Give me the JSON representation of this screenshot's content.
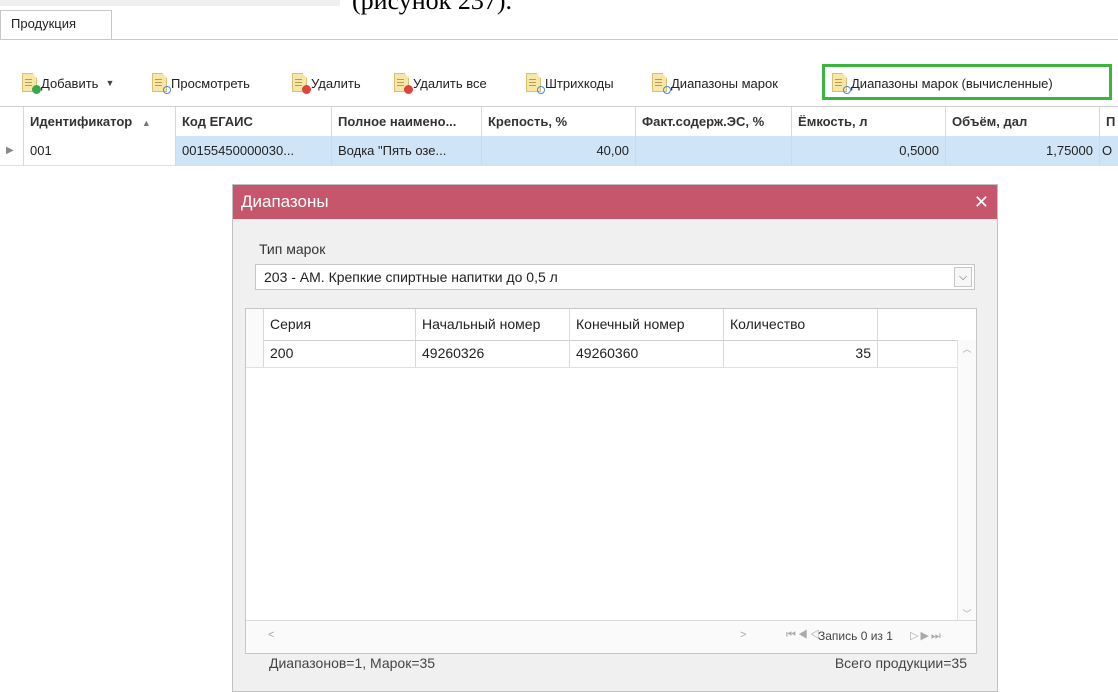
{
  "caption": "(рисунок 237).",
  "tab": {
    "label": "Продукция"
  },
  "toolbar": {
    "add": "Добавить",
    "view": "Просмотреть",
    "delete": "Удалить",
    "delete_all": "Удалить все",
    "barcodes": "Штрихкоды",
    "ranges": "Диапазоны марок",
    "ranges_calc": "Диапазоны марок (вычисленные)"
  },
  "grid": {
    "columns": [
      "Идентификатор",
      "Код ЕГАИС",
      "Полное наимено...",
      "Крепость, %",
      "Факт.содерж.ЭС, %",
      "Ёмкость, л",
      "Объём, дал",
      "П"
    ],
    "row": {
      "id": "001",
      "egais": "00155450000030...",
      "name": "Водка \"Пять озе...",
      "strength": "40,00",
      "fact": "",
      "capacity": "0,5000",
      "volume": "1,75000",
      "extra": "О"
    }
  },
  "dialog": {
    "title": "Диапазоны",
    "type_label": "Тип марок",
    "type_value": "203 - АМ. Крепкие спиртные напитки до 0,5 л",
    "columns": [
      "Серия",
      "Начальный номер",
      "Конечный номер",
      "Количество"
    ],
    "row": {
      "series": "200",
      "start": "49260326",
      "end": "49260360",
      "count": "35"
    },
    "record": "Запись 0 из 1",
    "footer_left": "Диапазонов=1, Марок=35",
    "footer_right": "Всего продукции=35"
  }
}
